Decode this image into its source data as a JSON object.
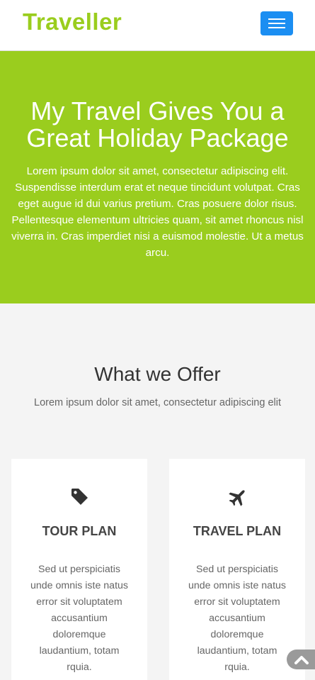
{
  "navbar": {
    "brand": "Traveller",
    "menu_toggle_icon": "hamburger-menu-icon",
    "brand_color": "#9acd1e",
    "toggle_color": "#1b8ef2"
  },
  "hero": {
    "title": "My Travel Gives You a Great Holiday Package",
    "text": "Lorem ipsum dolor sit amet, consectetur adipiscing elit. Suspendisse interdum erat et neque tincidunt volutpat. Cras eget augue id dui varius pretium. Cras posuere dolor risus. Pellentesque elementum ultricies quam, sit amet rhoncus nisl viverra in. Cras imperdiet nisi a euismod molestie. Ut a metus arcu.",
    "background_color": "#9acd1e"
  },
  "offer": {
    "title": "What we Offer",
    "subtitle": "Lorem ipsum dolor sit amet, consectetur adipiscing elit",
    "cards": [
      {
        "icon": "tag-icon",
        "title": "TOUR PLAN",
        "text": "Sed ut perspiciatis unde omnis iste natus error sit voluptatem accusantium doloremque laudantium, totam rquia."
      },
      {
        "icon": "plane-icon",
        "title": "TRAVEL PLAN",
        "text": "Sed ut perspiciatis unde omnis iste natus error sit voluptatem accusantium doloremque laudantium, totam rquia."
      }
    ]
  },
  "scroll_top": {
    "icon": "chevron-up-icon"
  }
}
